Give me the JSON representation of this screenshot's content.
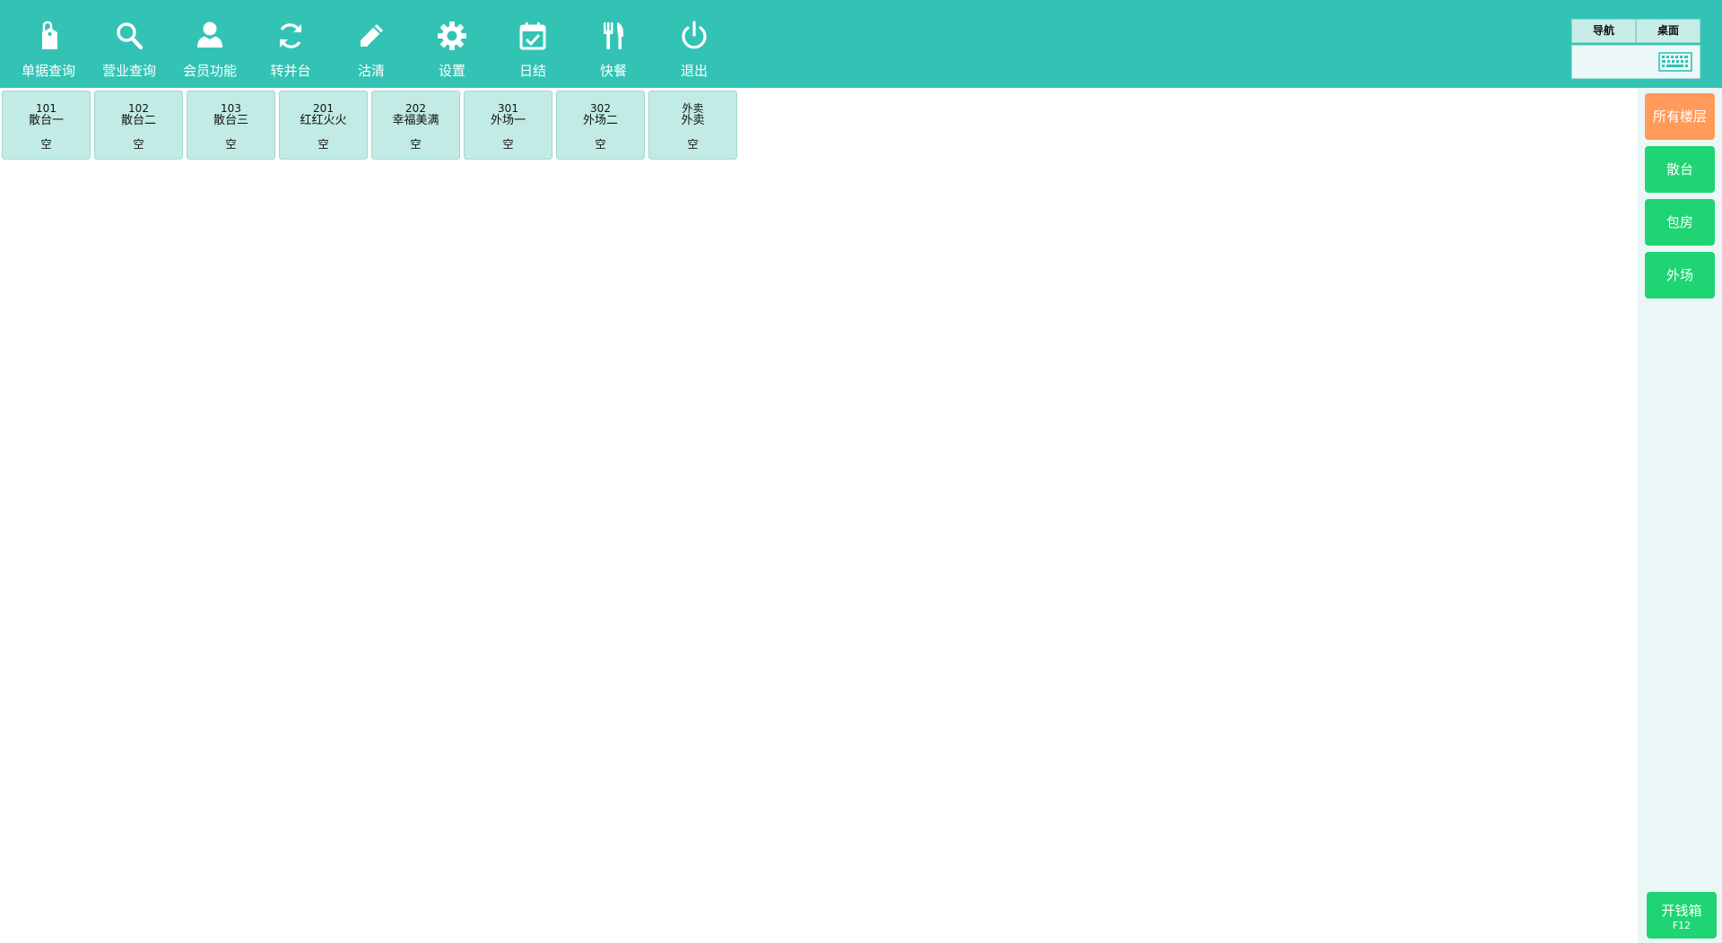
{
  "colors": {
    "header_bg": "#33c3b5",
    "card_bg": "#c2ebe5",
    "active_floor": "#ff9a5a",
    "floor_button": "#1fd472",
    "sidebar_bg": "#ebf7f6"
  },
  "toolbar": {
    "items": [
      {
        "label": "单据查询",
        "icon": "receipt-tag-icon"
      },
      {
        "label": "营业查询",
        "icon": "search-icon"
      },
      {
        "label": "会员功能",
        "icon": "user-icon"
      },
      {
        "label": "转并台",
        "icon": "refresh-icon"
      },
      {
        "label": "沽清",
        "icon": "pencil-icon"
      },
      {
        "label": "设置",
        "icon": "gear-icon"
      },
      {
        "label": "日结",
        "icon": "calendar-check-icon"
      },
      {
        "label": "快餐",
        "icon": "fork-knife-icon"
      },
      {
        "label": "退出",
        "icon": "power-icon"
      }
    ]
  },
  "nav": {
    "tab1": "导航",
    "tab2": "桌面",
    "keyboard_icon": "keyboard-icon"
  },
  "tables": [
    {
      "no": "101",
      "name": "散台一",
      "status": "空"
    },
    {
      "no": "102",
      "name": "散台二",
      "status": "空"
    },
    {
      "no": "103",
      "name": "散台三",
      "status": "空"
    },
    {
      "no": "201",
      "name": "红红火火",
      "status": "空"
    },
    {
      "no": "202",
      "name": "幸福美满",
      "status": "空"
    },
    {
      "no": "301",
      "name": "外场一",
      "status": "空"
    },
    {
      "no": "302",
      "name": "外场二",
      "status": "空"
    },
    {
      "no": "外卖",
      "name": "外卖",
      "status": "空"
    }
  ],
  "floors": [
    {
      "label": "所有楼层",
      "active": true
    },
    {
      "label": "散台",
      "active": false
    },
    {
      "label": "包房",
      "active": false
    },
    {
      "label": "外场",
      "active": false
    }
  ],
  "cash_drawer": {
    "label": "开钱箱",
    "shortcut": "F12"
  }
}
